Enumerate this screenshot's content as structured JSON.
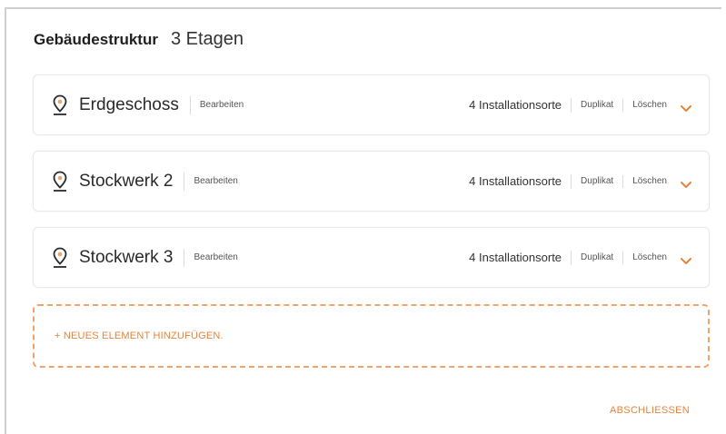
{
  "header": {
    "title": "Gebäudestruktur",
    "floor_count": "3 Etagen"
  },
  "floors": [
    {
      "name": "Erdgeschoss",
      "edit_label": "Bearbeiten",
      "locations": "4 Installationsorte",
      "duplicate_label": "Duplikat",
      "delete_label": "Löschen"
    },
    {
      "name": "Stockwerk 2",
      "edit_label": "Bearbeiten",
      "locations": "4 Installationsorte",
      "duplicate_label": "Duplikat",
      "delete_label": "Löschen"
    },
    {
      "name": "Stockwerk 3",
      "edit_label": "Bearbeiten",
      "locations": "4 Installationsorte",
      "duplicate_label": "Duplikat",
      "delete_label": "Löschen"
    }
  ],
  "add_element": {
    "label": "+ NEUES ELEMENT HINZUFÜGEN."
  },
  "footer": {
    "finish_label": "ABSCHLIESSEN"
  },
  "icons": {
    "location": "map-pin-icon",
    "expand": "chevron-down-icon"
  },
  "colors": {
    "accent": "#e8833a",
    "pin_accent": "#f0a46b"
  }
}
